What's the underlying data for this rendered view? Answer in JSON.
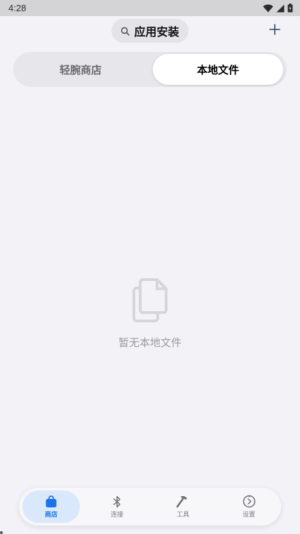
{
  "status_bar": {
    "time": "4:28",
    "icons": [
      "wifi-icon",
      "cellular-signal-icon",
      "battery-icon"
    ]
  },
  "top_bar": {
    "search_label": "应用安装",
    "search_icon": "search-icon",
    "add_icon": "plus-icon"
  },
  "tabs": [
    {
      "label": "轻腕商店",
      "selected": false
    },
    {
      "label": "本地文件",
      "selected": true
    }
  ],
  "empty_state": {
    "icon": "files-icon",
    "message": "暂无本地文件"
  },
  "bottom_nav": {
    "items": [
      {
        "label": "商店",
        "icon": "shopping-bag-icon",
        "active": true
      },
      {
        "label": "连接",
        "icon": "bluetooth-icon",
        "active": false
      },
      {
        "label": "工具",
        "icon": "hammer-icon",
        "active": false
      },
      {
        "label": "设置",
        "icon": "settings-icon",
        "active": false
      }
    ]
  },
  "colors": {
    "background": "#f2f2f7",
    "accent": "#1a73e8",
    "active_nav_bg": "#d9e8fb",
    "status_bar": "#d4d4d7"
  }
}
